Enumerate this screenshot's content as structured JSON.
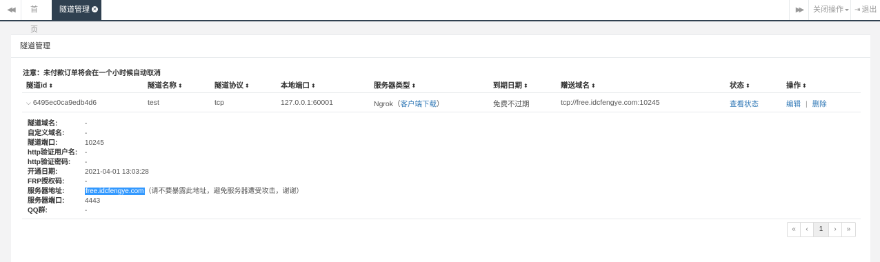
{
  "topbar": {
    "tabs": [
      {
        "label": "首页"
      },
      {
        "label": "隧道管理"
      }
    ],
    "close_ops_label": "关闭操作",
    "logout_label": "退出"
  },
  "panel": {
    "title": "隧道管理",
    "notice": "注意：未付款订单将会在一个小时候自动取消"
  },
  "table": {
    "columns": [
      "隧道id",
      "隧道名称",
      "隧道协议",
      "本地端口",
      "服务器类型",
      "到期日期",
      "赠送域名",
      "状态",
      "操作"
    ],
    "row": {
      "id": "6495ec0ca9edb4d6",
      "name": "test",
      "protocol": "tcp",
      "local_port": "127.0.0.1:60001",
      "server_type": "Ngrok",
      "client_download": "客户端下载",
      "server_type_paren_open": "（",
      "server_type_paren_close": "）",
      "expiry": "免费不过期",
      "domain": "tcp://free.idcfengye.com:10245",
      "status": "查看状态",
      "edit": "编辑",
      "sep": "|",
      "delete": "删除"
    }
  },
  "detail": {
    "items": [
      {
        "label": "隧道域名:",
        "value": "-"
      },
      {
        "label": "自定义域名:",
        "value": "-"
      },
      {
        "label": "隧道端口:",
        "value": "10245"
      },
      {
        "label": "http验证用户名:",
        "value": "-"
      },
      {
        "label": "http验证密码:",
        "value": "-"
      },
      {
        "label": "开通日期:",
        "value": "2021-04-01 13:03:28"
      },
      {
        "label": "FRP授权码:",
        "value": "-"
      },
      {
        "label": "服务器地址:",
        "value": "free.idcfengye.com",
        "note": "（请不要暴露此地址，避免服务器遭受攻击，谢谢）"
      },
      {
        "label": "服务器端口:",
        "value": "4443"
      },
      {
        "label": "QQ群:",
        "value": "-"
      }
    ]
  },
  "pagination": {
    "first": "«",
    "prev": "‹",
    "current": "1",
    "next": "›",
    "last": "»"
  },
  "icons": {
    "backward": "backward-icon",
    "forward": "forward-icon",
    "close": "close-icon",
    "sort": "sort-icon",
    "chevron": "chevron-down-icon",
    "logout": "logout-icon"
  },
  "colors": {
    "active_tab": "#2f4050",
    "link": "#337ab7",
    "highlight": "#3399ff"
  }
}
